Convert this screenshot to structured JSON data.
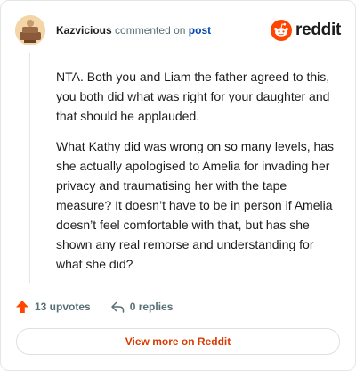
{
  "header": {
    "username": "Kazvicious",
    "action_text": "commented on",
    "link_text": "post",
    "brand": "reddit"
  },
  "comment": {
    "paragraphs": [
      "NTA. Both you and Liam the father agreed to this, you both did what was right for your daughter and that should he applauded.",
      "What Kathy did was wrong on so many levels, has she actually apologised to Amelia for invading her privacy and traumatising her with the tape measure? It doesn’t have to be in person if Amelia doesn’t feel comfortable with that, but has she shown any real remorse and understanding for what she did?"
    ]
  },
  "actions": {
    "upvotes": "13 upvotes",
    "replies": "0 replies"
  },
  "footer": {
    "view_more": "View more on Reddit"
  },
  "colors": {
    "brand_orange": "#ff4500",
    "link_blue": "#0045ac",
    "cta_orange": "#d93a00",
    "muted": "#576f76"
  },
  "icons": {
    "avatar": "avatar-icon",
    "logo": "reddit-snoo-icon",
    "upvote": "upvote-arrow-icon",
    "reply": "reply-arrow-icon"
  }
}
